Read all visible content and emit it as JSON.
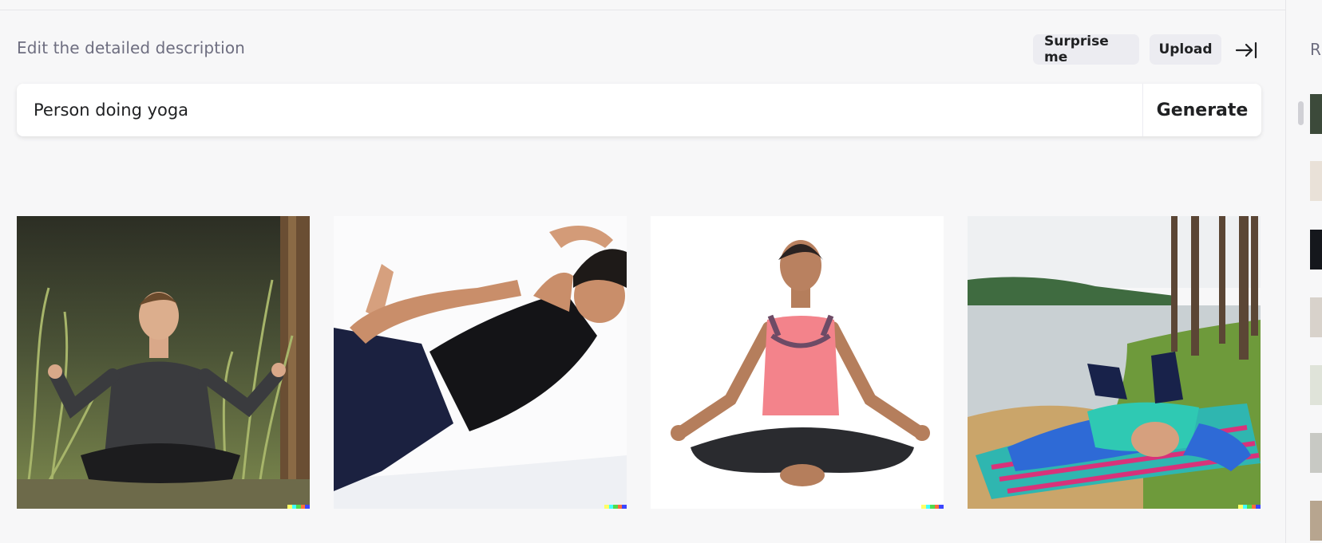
{
  "header": {
    "title": "Edit the detailed description",
    "surprise_label": "Surprise me",
    "upload_label": "Upload",
    "collapse_icon": "arrow-to-right-icon"
  },
  "prompt": {
    "value": "Person doing yoga",
    "generate_label": "Generate"
  },
  "results": [
    {
      "name": "result-image-1",
      "subject": "young man meditating cross-legged in tall grass"
    },
    {
      "name": "result-image-2",
      "subject": "man stretching in a backbend yoga pose"
    },
    {
      "name": "result-image-3",
      "subject": "woman meditating in lotus pose"
    },
    {
      "name": "result-image-4",
      "subject": "person lying on a striped blanket by a lake"
    }
  ],
  "sidebar": {
    "title": "R"
  },
  "colors": {
    "background": "#f7f7f8",
    "button_bg": "#ececf1",
    "text": "#202123",
    "muted": "#6e6e80",
    "signature": [
      "#ffff66",
      "#42ffff",
      "#51da4c",
      "#ff6e3c",
      "#3c46ff"
    ]
  }
}
